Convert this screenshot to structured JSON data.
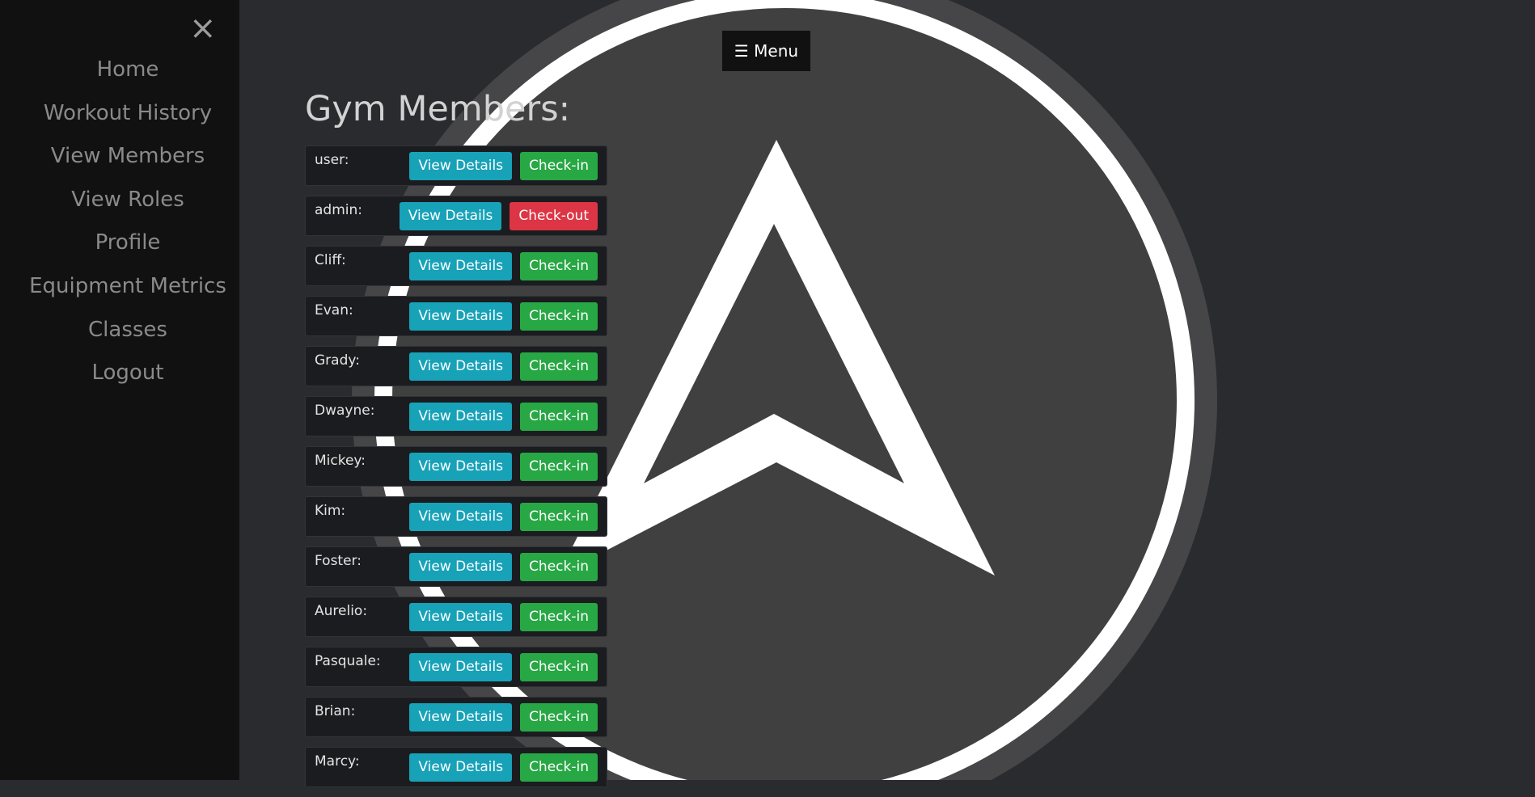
{
  "sidebar": {
    "close_icon": "close-icon",
    "items": [
      {
        "label": "Home"
      },
      {
        "label": "Workout History"
      },
      {
        "label": "View Members"
      },
      {
        "label": "View Roles"
      },
      {
        "label": "Profile"
      },
      {
        "label": "Equipment Metrics"
      },
      {
        "label": "Classes"
      },
      {
        "label": "Logout"
      }
    ]
  },
  "menu_button": {
    "label": "☰ Menu"
  },
  "page": {
    "title": "Gym Members:"
  },
  "members": [
    {
      "name": "user:",
      "details_label": "View Details",
      "action_label": "Check-in",
      "action": "check-in"
    },
    {
      "name": "admin:",
      "details_label": "View Details",
      "action_label": "Check-out",
      "action": "check-out"
    },
    {
      "name": "Cliff:",
      "details_label": "View Details",
      "action_label": "Check-in",
      "action": "check-in"
    },
    {
      "name": "Evan:",
      "details_label": "View Details",
      "action_label": "Check-in",
      "action": "check-in"
    },
    {
      "name": "Grady:",
      "details_label": "View Details",
      "action_label": "Check-in",
      "action": "check-in"
    },
    {
      "name": "Dwayne:",
      "details_label": "View Details",
      "action_label": "Check-in",
      "action": "check-in"
    },
    {
      "name": "Mickey:",
      "details_label": "View Details",
      "action_label": "Check-in",
      "action": "check-in"
    },
    {
      "name": "Kim:",
      "details_label": "View Details",
      "action_label": "Check-in",
      "action": "check-in"
    },
    {
      "name": "Foster:",
      "details_label": "View Details",
      "action_label": "Check-in",
      "action": "check-in"
    },
    {
      "name": "Aurelio:",
      "details_label": "View Details",
      "action_label": "Check-in",
      "action": "check-in"
    },
    {
      "name": "Pasquale:",
      "details_label": "View Details",
      "action_label": "Check-in",
      "action": "check-in"
    },
    {
      "name": "Brian:",
      "details_label": "View Details",
      "action_label": "Check-in",
      "action": "check-in"
    },
    {
      "name": "Marcy:",
      "details_label": "View Details",
      "action_label": "Check-in",
      "action": "check-in"
    }
  ],
  "colors": {
    "page_bg": "#292b2f",
    "sidebar_bg": "#111111",
    "details_button": "#17a2b8",
    "checkin_button": "#28a745",
    "checkout_button": "#dc3545"
  }
}
